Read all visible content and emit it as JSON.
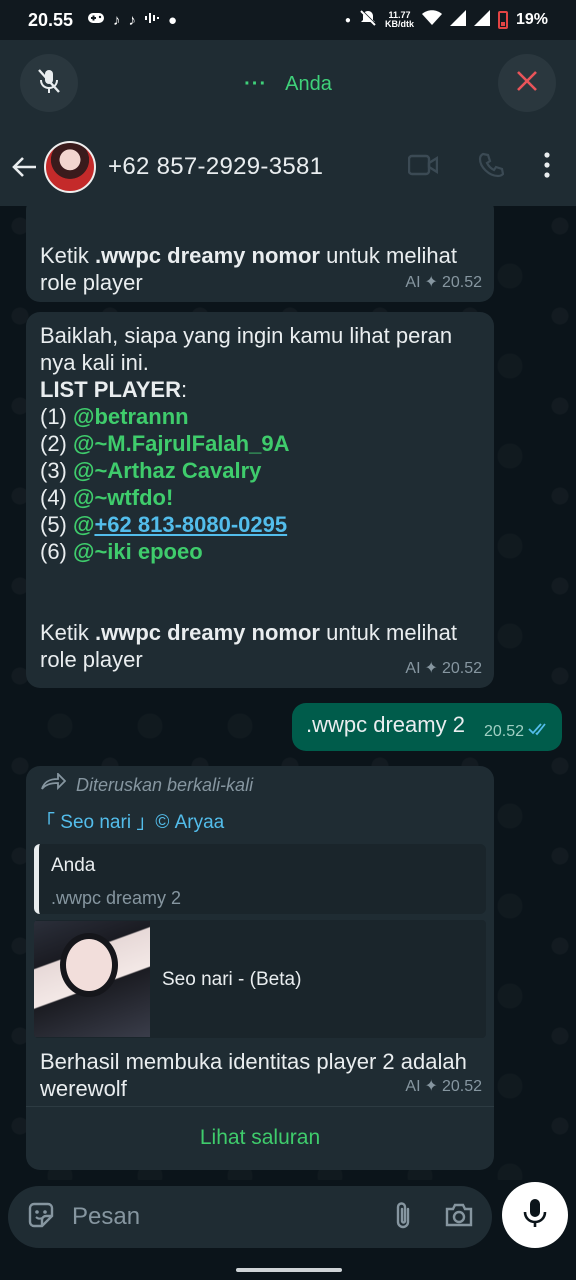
{
  "status": {
    "time": "20.55",
    "net_speed_value": "11.77",
    "net_speed_unit": "KB/dtk",
    "battery": "19%"
  },
  "call": {
    "title": "Anda",
    "dots": "···"
  },
  "header": {
    "contact": "+62 857-2929-3581"
  },
  "messages": {
    "m1": {
      "prefix": "Ketik ",
      "command": ".wwpc dreamy nomor",
      "suffix": " untuk melihat role player",
      "ai_label": "AI",
      "time": "20.52"
    },
    "m2": {
      "intro": "Baiklah, siapa yang ingin kamu lihat peran nya kali ini.",
      "list_title": "LIST PLAYER",
      "list_colon": ":",
      "players": [
        {
          "num": "(1) ",
          "at": "@",
          "name": "betrannn"
        },
        {
          "num": "(2) ",
          "at": "@",
          "name": "~M.FajrulFalah_9A"
        },
        {
          "num": "(3) ",
          "at": "@",
          "name": "~Arthaz Cavalry"
        },
        {
          "num": "(4) ",
          "at": "@",
          "name": "~wtfdo!"
        },
        {
          "num": "(5) ",
          "at": "@",
          "name": "+62 813-8080-0295"
        },
        {
          "num": "(6) ",
          "at": "@",
          "name": "~iki epoeo"
        }
      ],
      "prefix": "Ketik ",
      "command": ".wwpc dreamy nomor",
      "suffix": " untuk melihat role player",
      "ai_label": "AI",
      "time": "20.52"
    },
    "m3": {
      "text": ".wwpc dreamy 2",
      "time": "20.52"
    },
    "m4": {
      "forwarded": "Diteruskan berkali-kali",
      "channel": "「 Seo nari 」© Aryaa",
      "quote_author": "Anda",
      "quote_text": ".wwpc dreamy 2",
      "preview_title": "Seo nari - (Beta)",
      "text": "Berhasil membuka identitas player 2 adalah werewolf",
      "ai_label": "AI",
      "time": "20.52",
      "action": "Lihat saluran"
    }
  },
  "input": {
    "placeholder": "Pesan"
  },
  "colors": {
    "accent_green": "#3fcc6c",
    "link_blue": "#53bdeb",
    "outgoing_bubble": "#005c4b",
    "incoming_bubble": "#1f2c33",
    "end_call_red": "#e9545a"
  }
}
